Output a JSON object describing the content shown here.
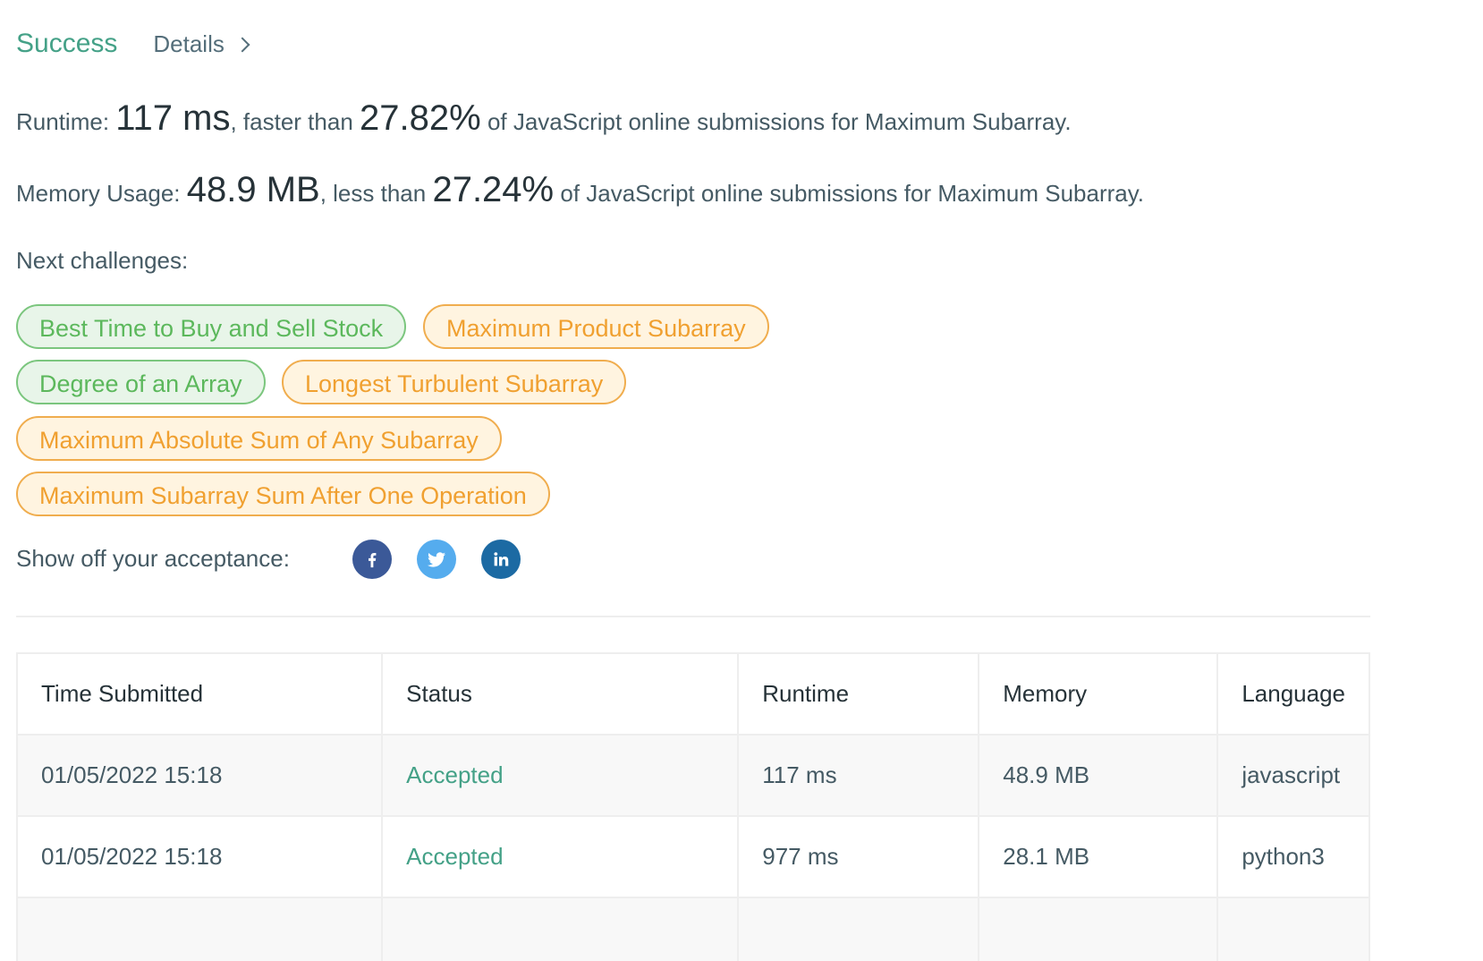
{
  "header": {
    "status": "Success",
    "details_label": "Details"
  },
  "runtime": {
    "label": "Runtime:",
    "value": "117 ms",
    "comparison": ", faster than",
    "percent": "27.82%",
    "suffix": "of JavaScript online submissions for Maximum Subarray."
  },
  "memory": {
    "label": "Memory Usage:",
    "value": "48.9 MB",
    "comparison": ", less than",
    "percent": "27.24%",
    "suffix": "of JavaScript online submissions for Maximum Subarray."
  },
  "next_challenges": {
    "label": "Next challenges:",
    "items": [
      {
        "label": "Best Time to Buy and Sell Stock",
        "difficulty": "easy"
      },
      {
        "label": "Maximum Product Subarray",
        "difficulty": "medium"
      },
      {
        "label": "Degree of an Array",
        "difficulty": "easy"
      },
      {
        "label": "Longest Turbulent Subarray",
        "difficulty": "medium"
      },
      {
        "label": "Maximum Absolute Sum of Any Subarray",
        "difficulty": "medium"
      },
      {
        "label": "Maximum Subarray Sum After One Operation",
        "difficulty": "medium"
      }
    ]
  },
  "share": {
    "label": "Show off your acceptance:",
    "icons": [
      "facebook-icon",
      "twitter-icon",
      "linkedin-icon"
    ]
  },
  "table": {
    "headers": [
      "Time Submitted",
      "Status",
      "Runtime",
      "Memory",
      "Language"
    ],
    "rows": [
      [
        "01/05/2022 15:18",
        "Accepted",
        "117 ms",
        "48.9 MB",
        "javascript"
      ],
      [
        "01/05/2022 15:18",
        "Accepted",
        "977 ms",
        "28.1 MB",
        "python3"
      ],
      [
        "",
        "",
        "",
        "",
        ""
      ]
    ]
  },
  "colors": {
    "success": "#44a187",
    "easy": "#5cb85c",
    "medium": "#f0a030",
    "facebook": "#3b5998",
    "twitter": "#55acee",
    "linkedin": "#1c6aa3"
  }
}
